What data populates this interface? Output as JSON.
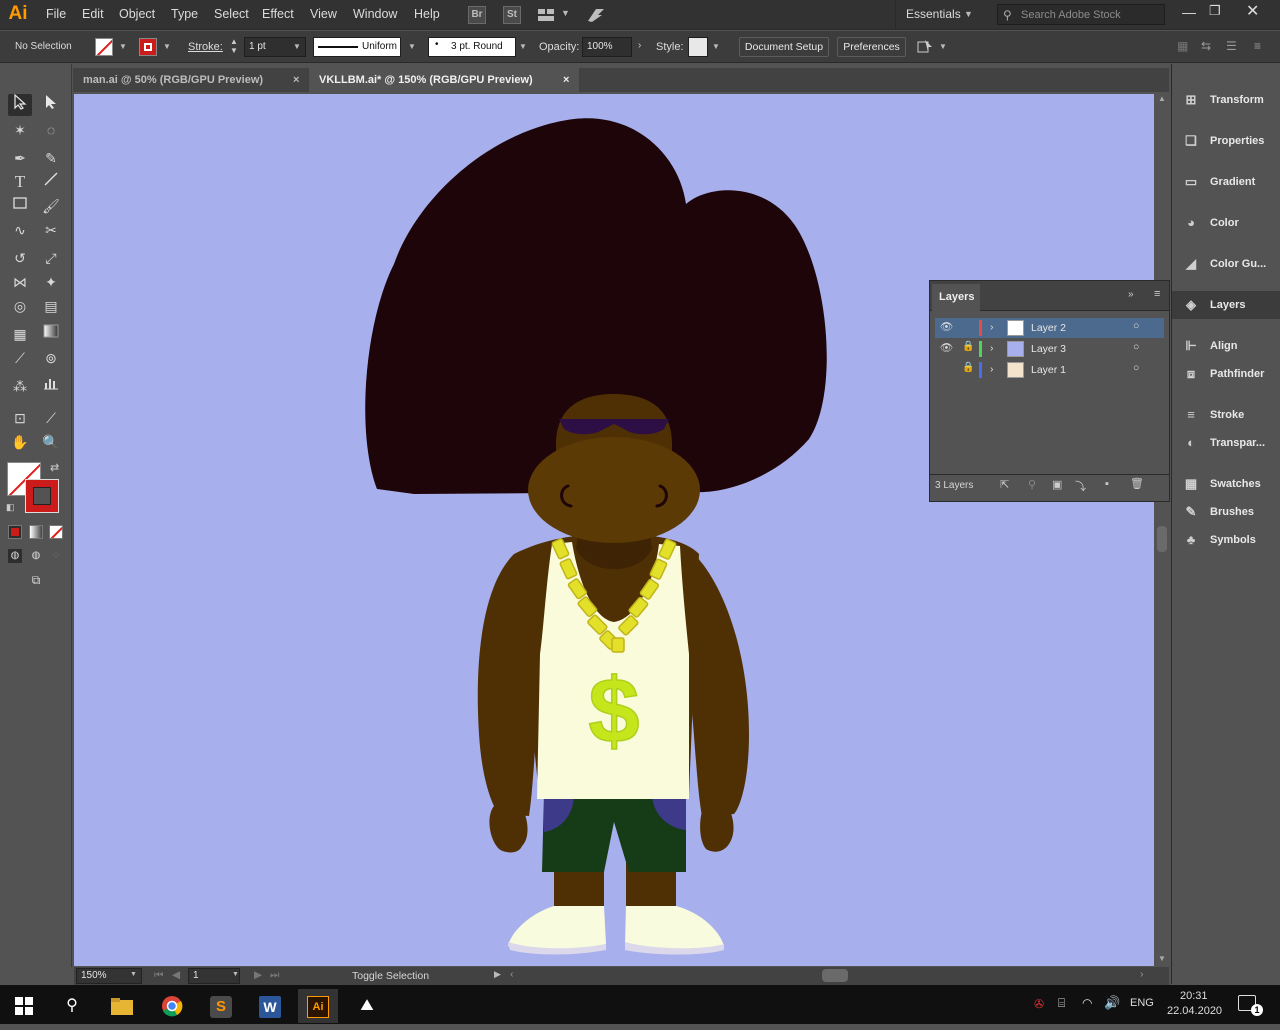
{
  "app": {
    "logo": "Ai",
    "menus": [
      "File",
      "Edit",
      "Object",
      "Type",
      "Select",
      "Effect",
      "View",
      "Window",
      "Help"
    ],
    "bridge": "Br",
    "stock": "St",
    "workspace": "Essentials",
    "search_placeholder": "Search Adobe Stock"
  },
  "control": {
    "selection": "No Selection",
    "stroke_label": "Stroke:",
    "stroke_weight": "1 pt",
    "profile": "Uniform",
    "brush": "3 pt. Round",
    "opacity_label": "Opacity:",
    "opacity": "100%",
    "style_label": "Style:",
    "document_setup": "Document Setup",
    "preferences": "Preferences"
  },
  "tabs": [
    {
      "label": "man.ai @ 50% (RGB/GPU Preview)",
      "active": false
    },
    {
      "label": "VKLLBM.ai* @ 150% (RGB/GPU Preview)",
      "active": true
    }
  ],
  "status": {
    "zoom": "150%",
    "artboard": "1",
    "tool": "Toggle Selection"
  },
  "layers_panel": {
    "title": "Layers",
    "layers": [
      {
        "name": "Layer 2",
        "color": "#e84a4a",
        "visible": true,
        "locked": false
      },
      {
        "name": "Layer 3",
        "color": "#4fd45a",
        "visible": true,
        "locked": true
      },
      {
        "name": "Layer 1",
        "color": "#4a6de8",
        "visible": false,
        "locked": true
      }
    ],
    "count": "3 Layers"
  },
  "dock": [
    "Transform",
    "Properties",
    "Gradient",
    "Color",
    "Color Gu...",
    "Layers",
    "Align",
    "Pathfinder",
    "Stroke",
    "Transpar...",
    "Swatches",
    "Brushes",
    "Symbols"
  ],
  "taskbar": {
    "lang": "ENG",
    "time": "20:31",
    "date": "22.04.2020",
    "notifications": "1"
  },
  "colors": {
    "canvas_bg": "#a7b0ed",
    "hair": "#1e0509",
    "skin": "#4f3004",
    "face": "#5c3a06",
    "shirt": "#f9fbda",
    "shorts": "#163b17",
    "pockets": "#3d3a8a",
    "chain": "#e3e02a",
    "dollar": "#c6e61c",
    "shoes": "#f8fbdd",
    "stroke_swatch": "#cc1b1b"
  }
}
